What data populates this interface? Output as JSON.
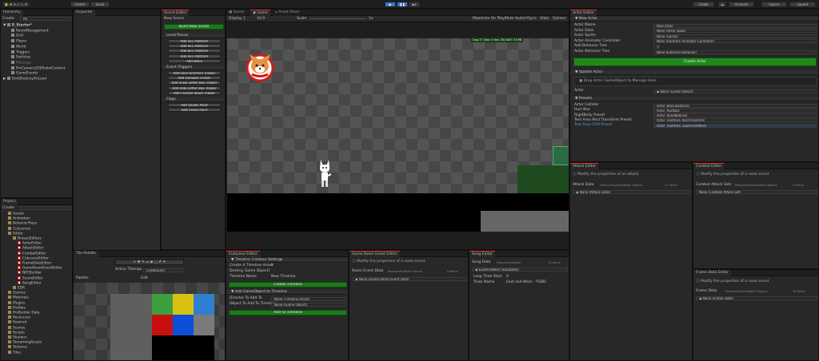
{
  "toolbar": {
    "pivot": "Center",
    "space": "Local",
    "play": "▶",
    "pause": "❚❚",
    "step": "▶|",
    "collab": "Collab",
    "account": "Account",
    "layers": "Layers",
    "layout": "Layout"
  },
  "hierarchy": {
    "tab": "Hierarchy",
    "create": "Create",
    "search": "All",
    "items": [
      "D_Starter*",
      "RoomManagement",
      "Grid",
      "Player",
      "World",
      "Triggers",
      "Particles",
      "Message",
      "ProCamera2D|ShakeContent",
      "GameEvents",
      "DontDestroyOnLoad"
    ]
  },
  "inspector": {
    "tab": "Inspector"
  },
  "scene_editor": {
    "tab": "Scene Editor",
    "new_scene": "New Scene",
    "build_btn": "Build New Scene",
    "sections": [
      {
        "title": "Level Pieces",
        "buttons": [
          "Add 4x1 Platform",
          "Add 6x1 Platform",
          "Add 8x1 Platform",
          "Add 4x1 Platform",
          "Add Block"
        ]
      },
      {
        "title": "Event Triggers",
        "buttons": [
          "Add Face Direction Trigger",
          "Add Damage Trigger",
          "Add Show Letter Box Trigger",
          "Add Hide Letter Box Trigger",
          "Add Change Room Trigger"
        ]
      },
      {
        "title": "Flags",
        "buttons": [
          "Add Spawn Point",
          "Add Check Point"
        ]
      }
    ]
  },
  "scene_view": {
    "tabs": [
      "Scene",
      "Game",
      "Asset Store"
    ],
    "display": "Display 1",
    "aspect": "16:9",
    "scale": "Scale",
    "scale_val": "1x",
    "options": [
      "Maximize On Play",
      "Mute Audio",
      "VSync",
      "Stats",
      "Gizmos"
    ],
    "hud": "Dog 37  [Nov 5 Nov 28]  WAIT 37/98"
  },
  "actor_editor": {
    "tab": "Actor Editor",
    "new_actor": "New Actor",
    "rows": [
      {
        "label": "Actor Name",
        "value": "New Actor"
      },
      {
        "label": "Actor Data",
        "value": "None (Actor Data)"
      },
      {
        "label": "Actor Sprite",
        "value": "None (Sprite)"
      },
      {
        "label": "Actor Animator Controller",
        "value": "None (Runtime Animator Controller)"
      },
      {
        "label": "Add Behavior Tree",
        "value": "✔"
      },
      {
        "label": "Actor Behavior Tree",
        "value": "None (External Behavior)"
      }
    ],
    "create_btn": "Create Actor",
    "update_section": "Update Actor",
    "drop_hint": "Drop Actor GameObject to Manage Here",
    "actor_label": "Actor",
    "actor_value": "None (Game Object)",
    "presets_section": "Presets",
    "presets": [
      {
        "label": "Actor Collider",
        "value": "Actor_BoxCollider2D"
      },
      {
        "label": "Hurt Box",
        "value": "Actor_HurtBox"
      },
      {
        "label": "RigidBody Preset",
        "value": "Actor_RigidBody2D"
      },
      {
        "label": "Text Area Rect Transform Preset",
        "value": "Actor_TextArea_RectTransform"
      },
      {
        "label": "Text Area STM Preset",
        "value": "Actor_TextArea_SuperTextMesh"
      }
    ]
  },
  "attack_editor": {
    "tab": "Attack Editor",
    "hint": "Modify the properties of an attack",
    "data_label": "Attack Data",
    "data_type": "Resources/Scriptable Objects",
    "count": "17 Items",
    "value": "None (Attack Data)"
  },
  "combat_editor": {
    "tab": "Combat Editor",
    "hint": "Modify the properties of a room event",
    "data_label": "Combat Attack Sets",
    "data_type": "Resources/Scriptable Objects",
    "count": "0 Items",
    "value": "None (Combat Attack Set)"
  },
  "frame_editor": {
    "tab": "Frame Data Editor",
    "hint": "Modify the properties of a room event",
    "data_label": "Frame Data",
    "data_type": "Resources/Scriptable Objects",
    "count": "16 Items",
    "value": "None (Frame Data)"
  },
  "project": {
    "tab": "Project",
    "create": "Create",
    "folders": [
      "Assets",
      "Animation",
      "BehaviorTrees",
      "Cutscenes",
      "Editor",
      "BreezeEditors",
      "ActorEditor",
      "AttackEditor",
      "CombatEditor",
      "CutsceneEditor",
      "FrameDataEditor",
      "GameRoomEventEditor",
      "NPCBuilder",
      "SceneEditor",
      "SongEditor",
      "EDR",
      "Gizmos",
      "Materials",
      "Plugins",
      "Prefabs",
      "ProBuilder Data",
      "Resources",
      "Rewired",
      "Scenes",
      "Scripts",
      "Shaders",
      "StreamingAssets",
      "Textures",
      "Tiles"
    ]
  },
  "tile_palette": {
    "tab": "Tile Palette",
    "active_label": "Active Tilemap",
    "active_value": "Foreground",
    "palette_label": "Palette",
    "edit": "Edit"
  },
  "cutscene_editor": {
    "tab": "Cutscene Editor",
    "section1": "Timeline Creation Settings",
    "rows": [
      {
        "label": "Create A Timeline Asset",
        "value": "✔"
      },
      {
        "label": "Destroy Game Object?",
        "value": ""
      },
      {
        "label": "Timeline Name",
        "value": "New Timeline"
      }
    ],
    "create_btn": "Create Timeline",
    "section2": "Add GameObject to Timeline",
    "rows2": [
      {
        "label": "Director To Add To",
        "value": "None (Timeline Asset)"
      },
      {
        "label": "Object To Add To Timeline",
        "value": "None (Game Object)"
      }
    ],
    "add_btn": "Add To Timeline"
  },
  "room_event_editor": {
    "tab": "Game Room Event Editor",
    "hint": "Modify the properties of a room event",
    "data_label": "Room Event Data",
    "data_type": "Resources/Room Events",
    "count": "0 Items",
    "value": "None (Game Room Event Data)"
  },
  "song_editor": {
    "tab": "Song Editor",
    "data_label": "Song Data",
    "data_type": "Resources/Audio",
    "count": "10 Items",
    "song_value": "EastAndWest (SongData)",
    "rows": [
      {
        "label": "Loop Time Start",
        "value": "0"
      },
      {
        "label": "Track Name",
        "value": "East and West - TUDD"
      }
    ]
  }
}
